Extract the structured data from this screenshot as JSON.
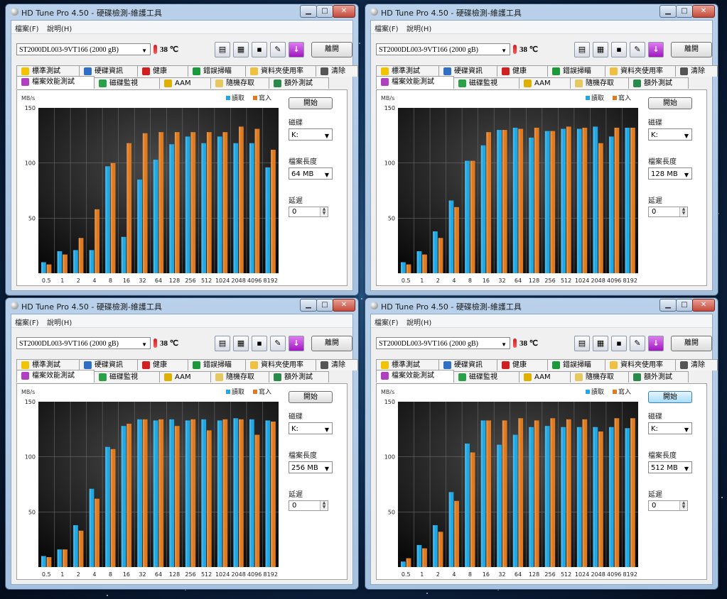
{
  "windows": [
    {
      "title": "HD Tune Pro 4.50 - 硬碟檢測-維護工具",
      "menu": [
        "檔案(F)",
        "說明(H)"
      ],
      "drive": "ST2000DL003-9VT166 (2000 gB)",
      "temperature": "38 ℃",
      "exit_label": "離開",
      "tabs_row1": [
        "標準測試",
        "硬碟資訊",
        "健康",
        "錯誤掃瞄",
        "資料夾使用率",
        "清除"
      ],
      "tabs_row2": [
        "檔案效能測試",
        "磁碟監視",
        "AAM",
        "隨機存取",
        "額外測試"
      ],
      "start_label": "開始",
      "disk_label": "磁碟",
      "disk_value": "K:",
      "file_length_label": "檔案長度",
      "file_length_value": "64 MB",
      "delay_label": "延遲",
      "delay_value": "0",
      "chart_data": {
        "type": "bar",
        "ylabel": "MB/s",
        "ylim": [
          0,
          150
        ],
        "yticks": [
          "150",
          "100",
          "50"
        ],
        "legend_placement": "top-right",
        "categories": [
          "0.5",
          "1",
          "2",
          "4",
          "8",
          "16",
          "32",
          "64",
          "128",
          "256",
          "512",
          "1024",
          "2048",
          "4096",
          "8192"
        ],
        "series": [
          {
            "name": "讀取",
            "color": "#1fa8e4",
            "values": [
              10,
              20,
              21,
              21,
              97,
              33,
              85,
              103,
              117,
              124,
              118,
              124,
              118,
              118,
              96
            ]
          },
          {
            "name": "寫入",
            "color": "#e07a1e",
            "values": [
              8,
              17,
              32,
              58,
              100,
              118,
              127,
              128,
              128,
              128,
              128,
              128,
              133,
              131,
              112
            ]
          }
        ]
      }
    },
    {
      "title": "HD Tune Pro 4.50 - 硬碟檢測-維護工具",
      "menu": [
        "檔案(F)",
        "說明(H)"
      ],
      "drive": "ST2000DL003-9VT166 (2000 gB)",
      "temperature": "38 ℃",
      "exit_label": "離開",
      "tabs_row1": [
        "標準測試",
        "硬碟資訊",
        "健康",
        "錯誤掃瞄",
        "資料夾使用率",
        "清除"
      ],
      "tabs_row2": [
        "檔案效能測試",
        "磁碟監視",
        "AAM",
        "隨機存取",
        "額外測試"
      ],
      "start_label": "開始",
      "disk_label": "磁碟",
      "disk_value": "K:",
      "file_length_label": "檔案長度",
      "file_length_value": "128 MB",
      "delay_label": "延遲",
      "delay_value": "0",
      "chart_data": {
        "type": "bar",
        "ylabel": "MB/s",
        "ylim": [
          0,
          150
        ],
        "yticks": [
          "150",
          "100",
          "50"
        ],
        "legend_placement": "top-right",
        "categories": [
          "0.5",
          "1",
          "2",
          "4",
          "8",
          "16",
          "32",
          "64",
          "128",
          "256",
          "512",
          "1024",
          "2048",
          "4096",
          "8192"
        ],
        "series": [
          {
            "name": "讀取",
            "color": "#1fa8e4",
            "values": [
              10,
              20,
              38,
              66,
              102,
              116,
              130,
              132,
              123,
              129,
              131,
              131,
              133,
              124,
              132
            ]
          },
          {
            "name": "寫入",
            "color": "#e07a1e",
            "values": [
              8,
              17,
              32,
              60,
              102,
              128,
              130,
              131,
              132,
              129,
              133,
              132,
              118,
              132,
              132
            ]
          }
        ]
      }
    },
    {
      "title": "HD Tune Pro 4.50 - 硬碟檢測-維護工具",
      "menu": [
        "檔案(F)",
        "說明(H)"
      ],
      "drive": "ST2000DL003-9VT166 (2000 gB)",
      "temperature": "38 ℃",
      "exit_label": "離開",
      "tabs_row1": [
        "標準測試",
        "硬碟資訊",
        "健康",
        "錯誤掃瞄",
        "資料夾使用率",
        "清除"
      ],
      "tabs_row2": [
        "檔案效能測試",
        "磁碟監視",
        "AAM",
        "隨機存取",
        "額外測試"
      ],
      "start_label": "開始",
      "disk_label": "磁碟",
      "disk_value": "K:",
      "file_length_label": "檔案長度",
      "file_length_value": "256 MB",
      "delay_label": "延遲",
      "delay_value": "0",
      "chart_data": {
        "type": "bar",
        "ylabel": "MB/s",
        "ylim": [
          0,
          150
        ],
        "yticks": [
          "150",
          "100",
          "50"
        ],
        "legend_placement": "top-right",
        "categories": [
          "0.5",
          "1",
          "2",
          "4",
          "8",
          "16",
          "32",
          "64",
          "128",
          "256",
          "512",
          "1024",
          "2048",
          "4096",
          "8192"
        ],
        "series": [
          {
            "name": "讀取",
            "color": "#1fa8e4",
            "values": [
              10,
              16,
              38,
              71,
              109,
              128,
              134,
              133,
              134,
              133,
              134,
              133,
              135,
              134,
              133
            ]
          },
          {
            "name": "寫入",
            "color": "#e07a1e",
            "values": [
              9,
              16,
              33,
              62,
              107,
              130,
              134,
              134,
              128,
              134,
              124,
              134,
              134,
              120,
              132
            ]
          }
        ]
      }
    },
    {
      "title": "HD Tune Pro 4.50 - 硬碟檢測-維護工具",
      "menu": [
        "檔案(F)",
        "說明(H)"
      ],
      "drive": "ST2000DL003-9VT166 (2000 gB)",
      "temperature": "38 ℃",
      "exit_label": "離開",
      "tabs_row1": [
        "標準測試",
        "硬碟資訊",
        "健康",
        "錯誤掃瞄",
        "資料夾使用率",
        "清除"
      ],
      "tabs_row2": [
        "檔案效能測試",
        "磁碟監視",
        "AAM",
        "隨機存取",
        "額外測試"
      ],
      "start_label": "開始",
      "disk_label": "磁碟",
      "disk_value": "K:",
      "file_length_label": "檔案長度",
      "file_length_value": "512 MB",
      "delay_label": "延遲",
      "delay_value": "0",
      "chart_data": {
        "type": "bar",
        "ylabel": "MB/s",
        "ylim": [
          0,
          150
        ],
        "yticks": [
          "150",
          "100",
          "50"
        ],
        "legend_placement": "top-right",
        "categories": [
          "0.5",
          "1",
          "2",
          "4",
          "8",
          "16",
          "32",
          "64",
          "128",
          "256",
          "512",
          "1024",
          "2048",
          "4096",
          "8192"
        ],
        "series": [
          {
            "name": "讀取",
            "color": "#1fa8e4",
            "values": [
              5,
              20,
              38,
              68,
              112,
              133,
              111,
              120,
              127,
              128,
              127,
              127,
              127,
              127,
              126
            ]
          },
          {
            "name": "寫入",
            "color": "#e07a1e",
            "values": [
              8,
              17,
              32,
              60,
              104,
              133,
              133,
              135,
              133,
              135,
              134,
              134,
              123,
              135,
              135
            ]
          }
        ]
      }
    }
  ]
}
